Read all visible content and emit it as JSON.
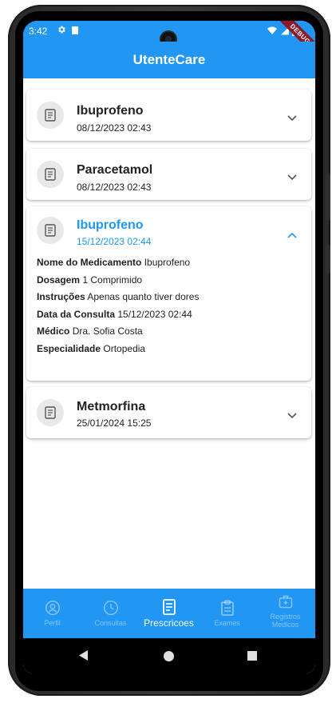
{
  "status_bar": {
    "time": "3:42",
    "icons": [
      "gear-icon",
      "sd-card-icon",
      "wifi-icon",
      "signal-icon",
      "battery-icon"
    ]
  },
  "debug_banner": "DEBUG",
  "app_bar": {
    "title": "UtenteCare"
  },
  "prescriptions": [
    {
      "name": "Ibuprofeno",
      "date": "08/12/2023 02:43",
      "expanded": false
    },
    {
      "name": "Paracetamol",
      "date": "08/12/2023 02:43",
      "expanded": false
    },
    {
      "name": "Ibuprofeno",
      "date": "15/12/2023 02:44",
      "expanded": true,
      "details": [
        {
          "label": "Nome do Medicamento",
          "value": "Ibuprofeno"
        },
        {
          "label": "Dosagem",
          "value": "1 Comprimido"
        },
        {
          "label": "Instruções",
          "value": "Apenas quanto tiver dores"
        },
        {
          "label": "Data da Consulta",
          "value": "15/12/2023 02:44"
        },
        {
          "label": "Médico",
          "value": "Dra. Sofia Costa"
        },
        {
          "label": "Especialidade",
          "value": "Ortopedia"
        }
      ]
    },
    {
      "name": "Metmorfina",
      "date": "25/01/2024 15:25",
      "expanded": false
    }
  ],
  "bottom_nav": {
    "items": [
      {
        "label": "Perfil",
        "icon": "person-icon",
        "active": false
      },
      {
        "label": "Consultas",
        "icon": "clock-icon",
        "active": false
      },
      {
        "label": "Prescricoes",
        "icon": "receipt-icon",
        "active": true
      },
      {
        "label": "Exames",
        "icon": "clipboard-icon",
        "active": false
      },
      {
        "label": "Registros Medicos",
        "icon": "medical-bag-icon",
        "active": false
      }
    ]
  },
  "colors": {
    "primary": "#2196F3",
    "debug_ribbon": "#8b1a2b"
  }
}
